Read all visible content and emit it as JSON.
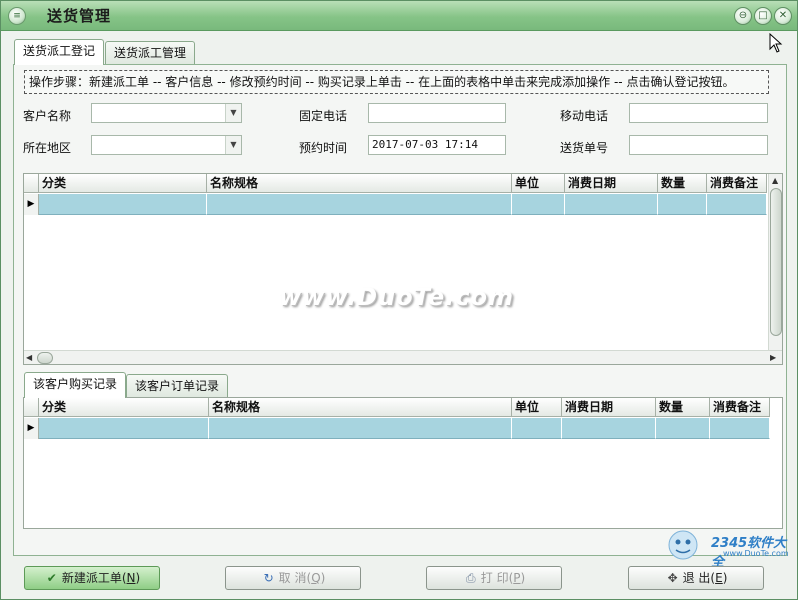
{
  "window": {
    "title": "送货管理",
    "buttons": [
      "⊖",
      "□",
      "✕"
    ]
  },
  "tabs": [
    {
      "label": "送货派工登记",
      "active": true
    },
    {
      "label": "送货派工管理",
      "active": false
    }
  ],
  "steps": "操作步骤：新建派工单 -- 客户信息 -- 修改预约时间 -- 购买记录上单击 -- 在上面的表格中单击来完成添加操作 -- 点击确认登记按钮。",
  "form": {
    "customer_name_label": "客户名称",
    "customer_name_value": "",
    "region_label": "所在地区",
    "region_value": "",
    "phone_label": "固定电话",
    "phone_value": "",
    "appointment_label": "预约时间",
    "appointment_value": "2017-07-03 17:14",
    "mobile_label": "移动电话",
    "mobile_value": "",
    "delivery_no_label": "送货单号",
    "delivery_no_value": ""
  },
  "main_grid": {
    "columns": [
      "分类",
      "名称规格",
      "单位",
      "消费日期",
      "数量",
      "消费备注"
    ]
  },
  "watermark": "www.DuoTe.com",
  "sub_tabs": [
    {
      "label": "该客户购买记录",
      "active": true
    },
    {
      "label": "该客户订单记录",
      "active": false
    }
  ],
  "sub_grid": {
    "columns": [
      "分类",
      "名称规格",
      "单位",
      "消费日期",
      "数量",
      "消费备注"
    ]
  },
  "buttons": {
    "new_label": "新建派工单",
    "new_key": "N",
    "cancel_label": "取 消",
    "cancel_key": "Q",
    "print_label": "打 印",
    "print_key": "P",
    "exit_label": "退 出",
    "exit_key": "E"
  },
  "logo": {
    "brand": "2345软件大全",
    "url": "www.DuoTe.com"
  },
  "colors": {
    "titlebar": "#86c487",
    "selected_row": "#a7d4df",
    "primary_button": "#8fce86"
  }
}
